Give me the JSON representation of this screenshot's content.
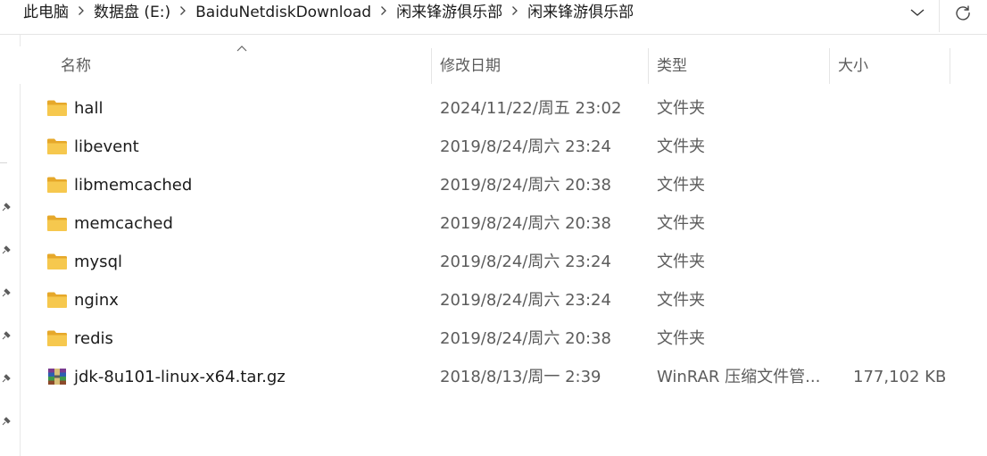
{
  "breadcrumb": {
    "items": [
      "此电脑",
      "数据盘 (E:)",
      "BaiduNetdiskDownload",
      "闲来锋游俱乐部",
      "闲来锋游俱乐部"
    ],
    "separator": ">"
  },
  "toolbar": {
    "dropdown_icon": "chevron-down-icon",
    "refresh_icon": "refresh-icon"
  },
  "columns": {
    "name": "名称",
    "date": "修改日期",
    "type": "类型",
    "size": "大小"
  },
  "files": [
    {
      "name": "hall",
      "date": "2024/11/22/周五 23:02",
      "type": "文件夹",
      "size": "",
      "icon": "folder-icon"
    },
    {
      "name": "libevent",
      "date": "2019/8/24/周六 23:24",
      "type": "文件夹",
      "size": "",
      "icon": "folder-icon"
    },
    {
      "name": "libmemcached",
      "date": "2019/8/24/周六 20:38",
      "type": "文件夹",
      "size": "",
      "icon": "folder-icon"
    },
    {
      "name": "memcached",
      "date": "2019/8/24/周六 20:38",
      "type": "文件夹",
      "size": "",
      "icon": "folder-icon"
    },
    {
      "name": "mysql",
      "date": "2019/8/24/周六 23:24",
      "type": "文件夹",
      "size": "",
      "icon": "folder-icon"
    },
    {
      "name": "nginx",
      "date": "2019/8/24/周六 23:24",
      "type": "文件夹",
      "size": "",
      "icon": "folder-icon"
    },
    {
      "name": "redis",
      "date": "2019/8/24/周六 20:38",
      "type": "文件夹",
      "size": "",
      "icon": "folder-icon"
    },
    {
      "name": "jdk-8u101-linux-x64.tar.gz",
      "date": "2018/8/13/周一 2:39",
      "type": "WinRAR 压缩文件管...",
      "size": "177,102 KB",
      "icon": "winrar-archive-icon"
    }
  ],
  "colors": {
    "folder": "#f4c34a",
    "folder_dark": "#e6a82a",
    "header_text": "#5c5c5c",
    "divider": "#e5e5e5"
  }
}
